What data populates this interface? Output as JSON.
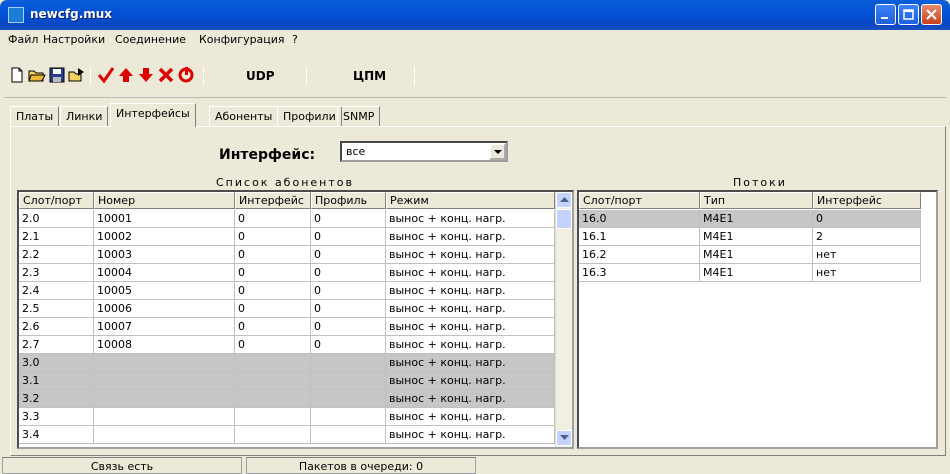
{
  "window": {
    "title": "newcfg.mux"
  },
  "menu": [
    "Файл",
    "Настройки",
    "Соединение",
    "Конфигурация",
    "?"
  ],
  "toolbar": {
    "icons": [
      "new-file-icon",
      "open-folder-icon",
      "save-disk-icon",
      "export-icon",
      "check-icon",
      "arrow-up-icon",
      "arrow-down-icon",
      "delete-x-icon",
      "reset-icon"
    ],
    "udp_label": "UDP",
    "cpm_label": "ЦПМ",
    "accent_red": "#e00000"
  },
  "tabs": [
    "Платы",
    "Линки",
    "Интерфейсы",
    "Абоненты",
    "Профили",
    "SNMP"
  ],
  "active_tab": "Интерфейсы",
  "filter": {
    "label": "Интерфейс:",
    "value": "все"
  },
  "subscribers": {
    "title": "Список абонентов",
    "columns": [
      "Слот/порт",
      "Номер",
      "Интерфейс",
      "Профиль",
      "Режим"
    ],
    "rows": [
      [
        "2.0",
        "10001",
        "0",
        "0",
        "вынос + конц. нагр."
      ],
      [
        "2.1",
        "10002",
        "0",
        "0",
        "вынос + конц. нагр."
      ],
      [
        "2.2",
        "10003",
        "0",
        "0",
        "вынос + конц. нагр."
      ],
      [
        "2.3",
        "10004",
        "0",
        "0",
        "вынос + конц. нагр."
      ],
      [
        "2.4",
        "10005",
        "0",
        "0",
        "вынос + конц. нагр."
      ],
      [
        "2.5",
        "10006",
        "0",
        "0",
        "вынос + конц. нагр."
      ],
      [
        "2.6",
        "10007",
        "0",
        "0",
        "вынос + конц. нагр."
      ],
      [
        "2.7",
        "10008",
        "0",
        "0",
        "вынос + конц. нагр."
      ],
      [
        "3.0",
        "",
        "",
        "",
        "вынос + конц. нагр."
      ],
      [
        "3.1",
        "",
        "",
        "",
        "вынос + конц. нагр."
      ],
      [
        "3.2",
        "",
        "",
        "",
        "вынос + конц. нагр."
      ],
      [
        "3.3",
        "",
        "",
        "",
        "вынос + конц. нагр."
      ],
      [
        "3.4",
        "",
        "",
        "",
        "вынос + конц. нагр."
      ]
    ]
  },
  "streams": {
    "title": "Потоки",
    "columns": [
      "Слот/порт",
      "Тип",
      "Интерфейс"
    ],
    "rows": [
      [
        "16.0",
        "M4E1",
        "0"
      ],
      [
        "16.1",
        "M4E1",
        "2"
      ],
      [
        "16.2",
        "M4E1",
        "нет"
      ],
      [
        "16.3",
        "M4E1",
        "нет"
      ]
    ]
  },
  "status": {
    "connection": "Связь есть",
    "queue": "Пакетов в очереди: 0"
  }
}
